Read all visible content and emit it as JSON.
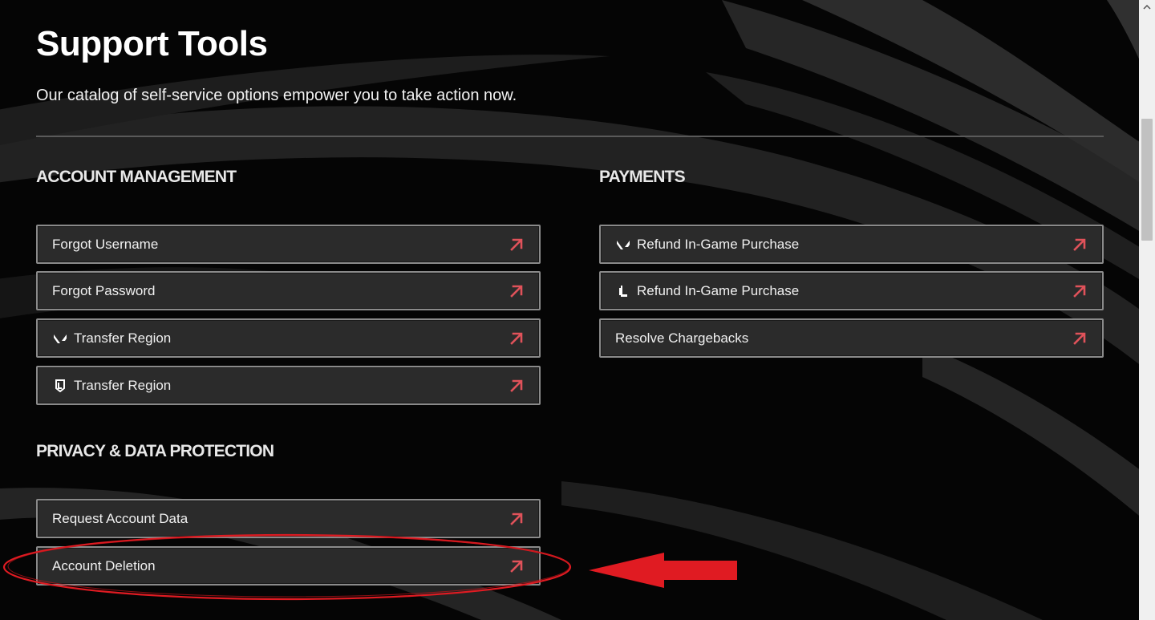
{
  "page": {
    "title": "Support Tools",
    "subtitle": "Our catalog of self-service options empower you to take action now."
  },
  "sections": {
    "account": {
      "heading": "ACCOUNT MANAGEMENT",
      "items": [
        {
          "label": "Forgot Username",
          "icon": ""
        },
        {
          "label": "Forgot Password",
          "icon": ""
        },
        {
          "label": "Transfer Region",
          "icon": "valorant-icon"
        },
        {
          "label": "Transfer Region",
          "icon": "league-of-legends-icon"
        }
      ]
    },
    "payments": {
      "heading": "PAYMENTS",
      "items": [
        {
          "label": "Refund In-Game Purchase",
          "icon": "valorant-icon"
        },
        {
          "label": "Refund In-Game Purchase",
          "icon": "legends-of-runeterra-icon"
        },
        {
          "label": "Resolve Chargebacks",
          "icon": ""
        }
      ]
    },
    "privacy": {
      "heading": "PRIVACY & DATA PROTECTION",
      "items": [
        {
          "label": "Request Account Data",
          "icon": ""
        },
        {
          "label": "Account Deletion",
          "icon": ""
        }
      ]
    }
  },
  "colors": {
    "background": "#050505",
    "card_background": "#2b2b2b",
    "card_border": "#8a8a8a",
    "arrow_accent": "#e0525a",
    "annotation_red": "#e01b22"
  },
  "icons": {
    "link_arrow": "arrow-up-right-icon"
  }
}
